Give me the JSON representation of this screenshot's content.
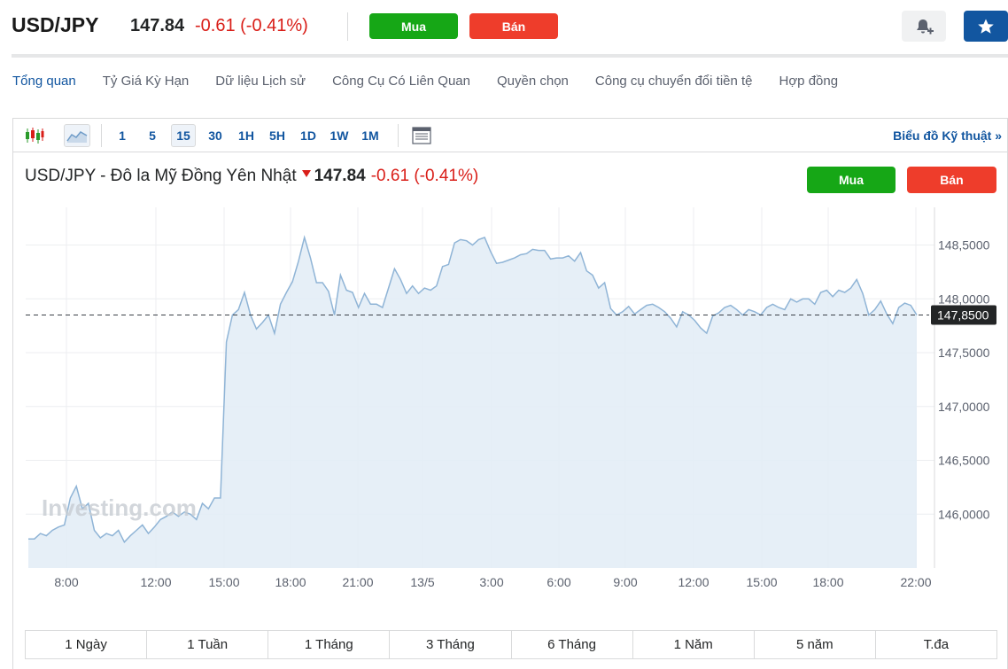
{
  "header": {
    "symbol": "USD/JPY",
    "price": "147.84",
    "change": "-0.61 (-0.41%)",
    "buy_label": "Mua",
    "sell_label": "Bán",
    "bell_icon": "bell-plus-icon",
    "star_icon": "star-icon"
  },
  "nav": {
    "tabs": [
      "Tổng quan",
      "Tỷ Giá Kỳ Hạn",
      "Dữ liệu Lịch sử",
      "Công Cụ Có Liên Quan",
      "Quyền chọn",
      "Công cụ chuyển đổi tiền tệ",
      "Hợp đồng"
    ],
    "active": 0
  },
  "toolbar": {
    "candle_icon": "candlestick-icon",
    "area_icon": "area-chart-icon",
    "timeframes": [
      "1",
      "5",
      "15",
      "30",
      "1H",
      "5H",
      "1D",
      "1W",
      "1M"
    ],
    "active_timeframe": "15",
    "table_icon": "table-icon",
    "tech_link": "Biểu đồ Kỹ thuật »"
  },
  "chart_title": {
    "name": "USD/JPY - Đô la Mỹ Đồng Yên Nhật",
    "price": "147.84",
    "change": "-0.61 (-0.41%)",
    "buy_label": "Mua",
    "sell_label": "Bán"
  },
  "watermark": "Investing.com",
  "colors": {
    "accent": "#1256a0",
    "buy": "#16a716",
    "sell": "#ee3d2b",
    "down": "#d91e18",
    "line": "#8fb4d6",
    "area": "#e3edf6"
  },
  "chart_data": {
    "type": "area",
    "title": "USD/JPY - Đô la Mỹ Đồng Yên Nhật",
    "xlabel": "",
    "ylabel": "",
    "x_ticks": [
      "8:00",
      "12:00",
      "15:00",
      "18:00",
      "21:00",
      "13/5",
      "3:00",
      "6:00",
      "9:00",
      "12:00",
      "15:00",
      "18:00",
      "22:00"
    ],
    "y_ticks": [
      "146,0000",
      "146,5000",
      "147,0000",
      "147,5000",
      "148,0000",
      "148,5000"
    ],
    "ylim": [
      145.5,
      148.85
    ],
    "current_value": 147.85,
    "current_label": "147,8500",
    "grid": true,
    "series": [
      {
        "values": [
          145.77,
          145.77,
          145.82,
          145.8,
          145.85,
          145.88,
          145.9,
          146.15,
          146.26,
          146.05,
          146.1,
          145.85,
          145.78,
          145.82,
          145.8,
          145.85,
          145.74,
          145.8,
          145.85,
          145.9,
          145.82,
          145.88,
          145.95,
          145.98,
          146.02,
          145.98,
          146.02,
          146.0,
          145.95,
          146.1,
          146.05,
          146.15,
          146.15,
          147.6,
          147.85,
          147.9,
          148.06,
          147.85,
          147.72,
          147.78,
          147.85,
          147.68,
          147.95,
          148.06,
          148.16,
          148.35,
          148.57,
          148.38,
          148.15,
          148.15,
          148.07,
          147.85,
          148.22,
          148.08,
          148.06,
          147.92,
          148.05,
          147.95,
          147.95,
          147.92,
          148.1,
          148.28,
          148.18,
          148.05,
          148.12,
          148.05,
          148.1,
          148.08,
          148.12,
          148.3,
          148.32,
          148.52,
          148.55,
          148.54,
          148.5,
          148.55,
          148.57,
          148.44,
          148.33,
          148.34,
          148.36,
          148.38,
          148.41,
          148.42,
          148.46,
          148.45,
          148.45,
          148.37,
          148.38,
          148.38,
          148.4,
          148.35,
          148.43,
          148.26,
          148.22,
          148.1,
          148.15,
          147.91,
          147.85,
          147.88,
          147.93,
          147.86,
          147.9,
          147.94,
          147.95,
          147.92,
          147.88,
          147.82,
          147.74,
          147.88,
          147.85,
          147.8,
          147.73,
          147.68,
          147.84,
          147.87,
          147.92,
          147.94,
          147.9,
          147.85,
          147.9,
          147.88,
          147.85,
          147.92,
          147.95,
          147.92,
          147.9,
          148.0,
          147.97,
          148.0,
          148.0,
          147.95,
          148.06,
          148.08,
          148.02,
          148.08,
          148.06,
          148.1,
          148.18,
          148.05,
          147.85,
          147.9,
          147.98,
          147.86,
          147.77,
          147.92,
          147.96,
          147.94,
          147.85
        ]
      }
    ]
  },
  "ranges": [
    "1 Ngày",
    "1 Tuần",
    "1 Tháng",
    "3 Tháng",
    "6 Tháng",
    "1 Năm",
    "5 năm",
    "T.đa"
  ]
}
